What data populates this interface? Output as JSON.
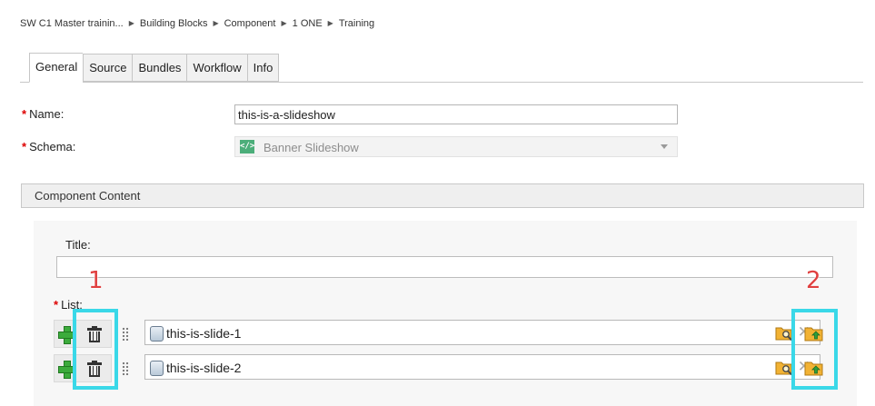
{
  "breadcrumb": [
    "SW C1 Master trainin...",
    "Building Blocks",
    "Component",
    "1 ONE",
    "Training"
  ],
  "tabs": [
    "General",
    "Source",
    "Bundles",
    "Workflow",
    "Info"
  ],
  "form": {
    "required_mark": "*",
    "name_label": "Name:",
    "name_value": "this-is-a-slideshow",
    "schema_label": "Schema:",
    "schema_value": "Banner Slideshow",
    "schema_icon": "</>"
  },
  "component_content": {
    "header": "Component Content",
    "title_label": "Title:",
    "title_value": "",
    "list_label": "List:",
    "items": [
      {
        "value": "this-is-slide-1"
      },
      {
        "value": "this-is-slide-2"
      }
    ]
  },
  "icons": {
    "clear": "✕"
  },
  "annotations": {
    "callout_1": "1",
    "callout_2": "2",
    "color": "#3ad8e8",
    "number_color": "#e04040"
  },
  "colors": {
    "required": "#dd0000",
    "schema_icon_bg": "#4cae7a",
    "add_green": "#3cab3c"
  }
}
